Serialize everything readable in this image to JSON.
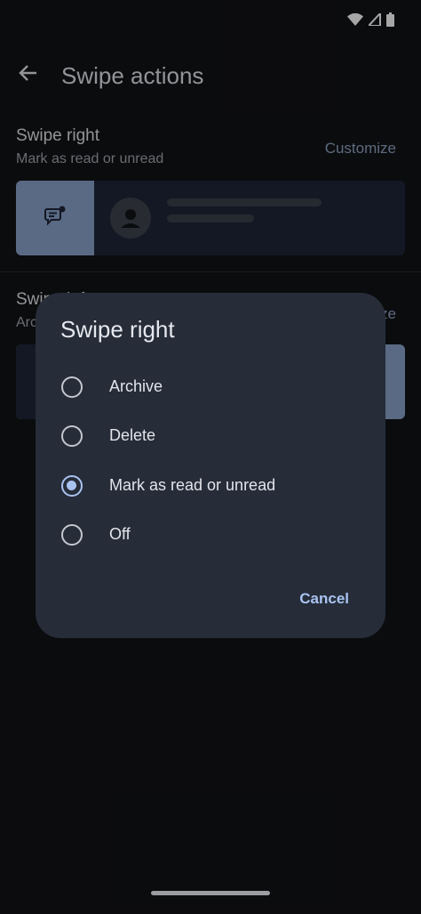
{
  "app_bar": {
    "title": "Swipe actions"
  },
  "swipe_right": {
    "title": "Swipe right",
    "subtitle": "Mark as read or unread",
    "customize_label": "Customize"
  },
  "swipe_left": {
    "title": "Swipe left",
    "subtitle": "Archive",
    "customize_label": "Customize"
  },
  "dialog": {
    "title": "Swipe right",
    "options": [
      {
        "label": "Archive",
        "selected": false
      },
      {
        "label": "Delete",
        "selected": false
      },
      {
        "label": "Mark as read or unread",
        "selected": true
      },
      {
        "label": "Off",
        "selected": false
      }
    ],
    "cancel_label": "Cancel"
  },
  "colors": {
    "background": "#121316",
    "dialog": "#262d39",
    "accent": "#a9c3f0",
    "action_panel": "#8ba4cb"
  }
}
